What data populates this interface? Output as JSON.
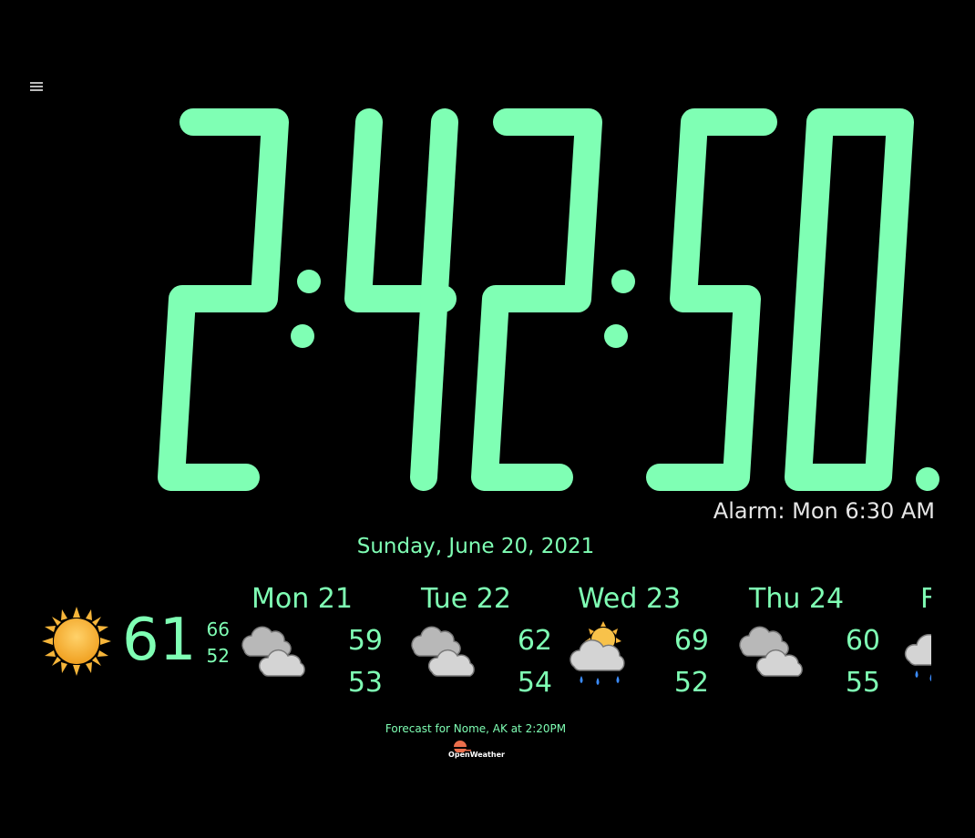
{
  "menu": {
    "icon": "hamburger-menu-icon"
  },
  "clock": {
    "time": "2:42:50.",
    "digits": [
      "2",
      ":",
      "4",
      "2",
      ":",
      "5",
      "0",
      "."
    ],
    "color": "#7fffb4"
  },
  "alarm": {
    "text": "Alarm: Mon 6:30 AM"
  },
  "date": {
    "text": "Sunday, June 20, 2021"
  },
  "current": {
    "icon": "sun-icon",
    "temp": "61",
    "hi": "66",
    "lo": "52"
  },
  "forecast": [
    {
      "label": "Mon 21",
      "icon": "cloudy-icon",
      "hi": "59",
      "lo": "53"
    },
    {
      "label": "Tue 22",
      "icon": "cloudy-icon",
      "hi": "62",
      "lo": "54"
    },
    {
      "label": "Wed 23",
      "icon": "partly-sunny-rain-icon",
      "hi": "69",
      "lo": "52"
    },
    {
      "label": "Thu 24",
      "icon": "cloudy-icon",
      "hi": "60",
      "lo": "55"
    },
    {
      "label": "F",
      "icon": "rain-cloud-icon",
      "hi": "",
      "lo": ""
    }
  ],
  "footer": {
    "note": "Forecast for Nome, AK at 2:20PM",
    "logo_text": "OpenWeather"
  },
  "colors": {
    "accent": "#7fffb4",
    "background": "#000000",
    "alarm_text": "#e6e6e6"
  }
}
